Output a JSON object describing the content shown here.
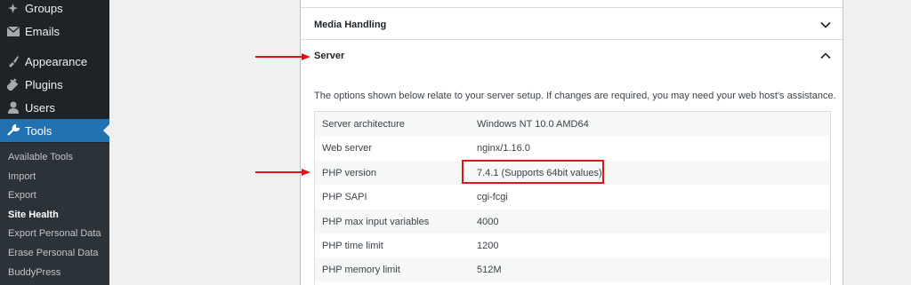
{
  "sidebar": {
    "items": [
      {
        "label": "Groups",
        "icon": "groups-icon"
      },
      {
        "label": "Emails",
        "icon": "email-icon"
      },
      {
        "label": "Appearance",
        "icon": "paintbrush-icon"
      },
      {
        "label": "Plugins",
        "icon": "plug-icon"
      },
      {
        "label": "Users",
        "icon": "user-icon"
      },
      {
        "label": "Tools",
        "icon": "wrench-icon"
      }
    ],
    "submenu": [
      "Available Tools",
      "Import",
      "Export",
      "Site Health",
      "Export Personal Data",
      "Erase Personal Data",
      "BuddyPress"
    ]
  },
  "main": {
    "media_handling_title": "Media Handling",
    "server_title": "Server",
    "description": "The options shown below relate to your server setup. If changes are required, you may need your web host's assistance.",
    "rows": [
      {
        "key": "Server architecture",
        "value": "Windows NT 10.0 AMD64"
      },
      {
        "key": "Web server",
        "value": "nginx/1.16.0"
      },
      {
        "key": "PHP version",
        "value": "7.4.1 (Supports 64bit values)"
      },
      {
        "key": "PHP SAPI",
        "value": "cgi-fcgi"
      },
      {
        "key": "PHP max input variables",
        "value": "4000"
      },
      {
        "key": "PHP time limit",
        "value": "1200"
      },
      {
        "key": "PHP memory limit",
        "value": "512M"
      }
    ]
  },
  "colors": {
    "sidebar_bg": "#1d2327",
    "active_bg": "#2271b1",
    "annotation_red": "#e3141b"
  }
}
